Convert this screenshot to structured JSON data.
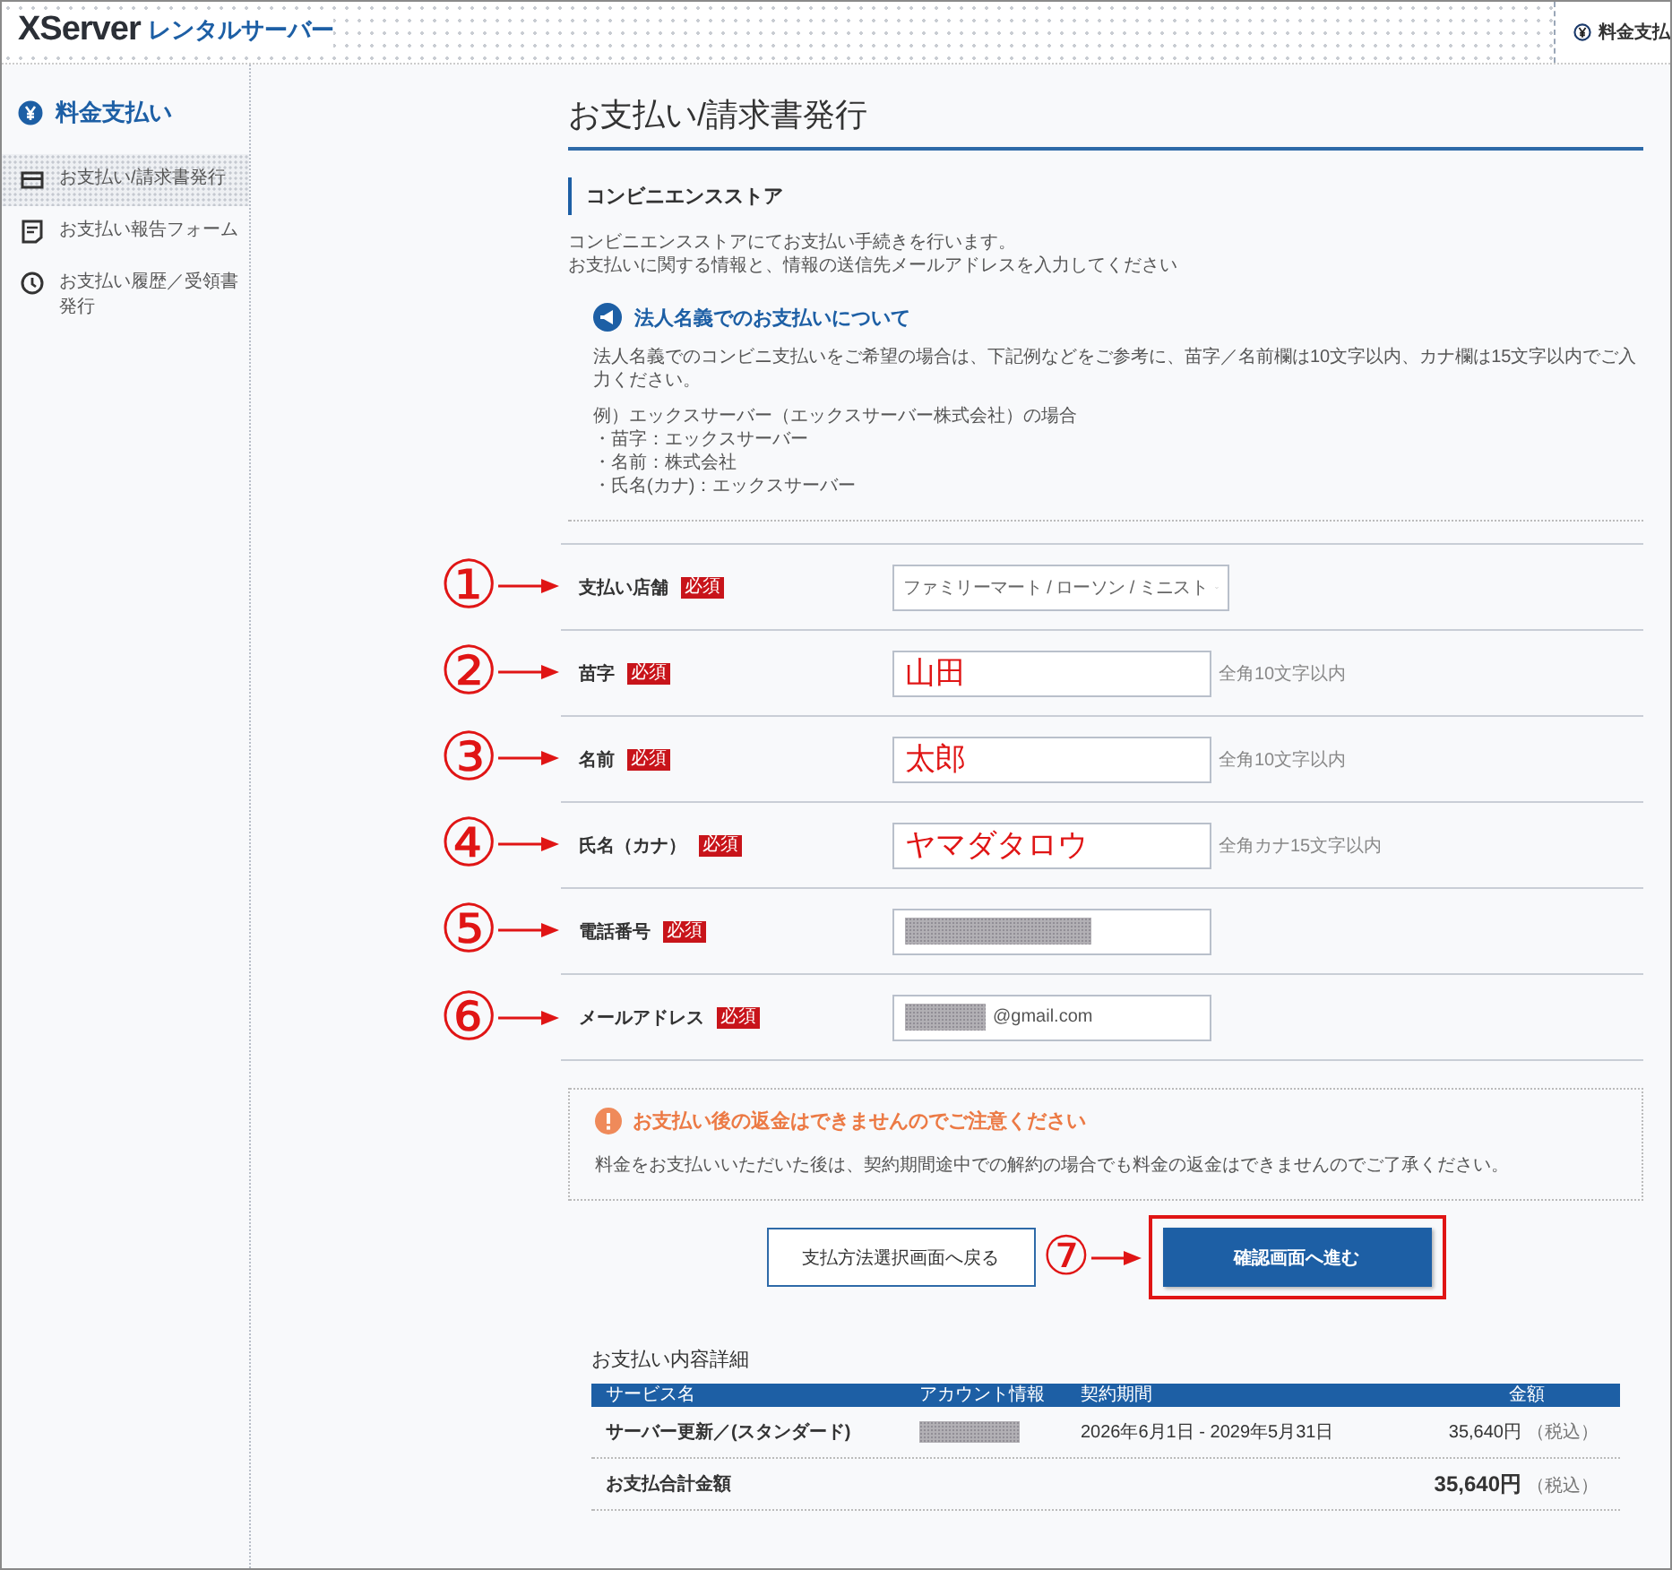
{
  "header": {
    "logo_main": "XServer",
    "logo_sub": "レンタルサーバー",
    "menu_label": "料金支払"
  },
  "sidebar": {
    "title": "料金支払い",
    "items": [
      {
        "label": "お支払い/請求書発行",
        "selected": true
      },
      {
        "label": "お支払い報告フォーム",
        "selected": false
      },
      {
        "label": "お支払い履歴／受領書発行",
        "selected": false
      }
    ]
  },
  "page_title": "お支払い/請求書発行",
  "section_title": "コンビニエンスストア",
  "intro": [
    "コンビニエンスストアにてお支払い手続きを行います。",
    "お支払いに関する情報と、情報の送信先メールアドレスを入力してください"
  ],
  "notice": {
    "title": "法人名義でのお支払いについて",
    "body": "法人名義でのコンビニ支払いをご希望の場合は、下記例などをご参考に、苗字／名前欄は10文字以内、カナ欄は15文字以内でご入力ください。",
    "example": [
      "例）エックスサーバー（エックスサーバー株式会社）の場合",
      "・苗字：エックスサーバー",
      "・名前：株式会社",
      "・氏名(カナ)：エックスサーバー"
    ]
  },
  "form": {
    "rows": [
      {
        "annotation": "①",
        "label": "支払い店舗",
        "badge": "必須",
        "kind": "select",
        "value": "ファミリーマート / ローソン / ミニスト"
      },
      {
        "annotation": "②",
        "label": "苗字",
        "badge": "必須",
        "kind": "text",
        "value": "山田",
        "hint": "全角10文字以内",
        "highlighted": true
      },
      {
        "annotation": "③",
        "label": "名前",
        "badge": "必須",
        "kind": "text",
        "value": "太郎",
        "hint": "全角10文字以内",
        "highlighted": true
      },
      {
        "annotation": "④",
        "label": "氏名（カナ）",
        "badge": "必須",
        "kind": "text",
        "value": "ヤマダタロウ",
        "hint": "全角カナ15文字以内",
        "highlighted": true
      },
      {
        "annotation": "⑤",
        "label": "電話番号",
        "badge": "必須",
        "kind": "text",
        "redacted": true
      },
      {
        "annotation": "⑥",
        "label": "メールアドレス",
        "badge": "必須",
        "kind": "text",
        "value": "@gmail.com",
        "highlighted": false,
        "redacted": true
      }
    ]
  },
  "warning": {
    "title": "お支払い後の返金はできませんのでご注意ください",
    "body": "料金をお支払いいただいた後は、契約期間途中での解約の場合でも料金の返金はできませんのでご了承ください。"
  },
  "buttons": [
    {
      "kind": "secondary",
      "label": "支払方法選択画面へ戻る",
      "highlighted": false
    },
    {
      "kind": "primary",
      "label": "確認画面へ進む",
      "highlighted": true,
      "annotation": "⑦"
    }
  ],
  "details": {
    "title": "お支払い内容詳細",
    "columns": [
      "サービス名",
      "アカウント情報",
      "契約期間",
      "金額"
    ],
    "rows": [
      {
        "service": "サーバー更新／(スタンダード)",
        "account_redacted": true,
        "period": "2026年6月1日 - 2029年5月31日",
        "amount": "35,640円",
        "tax": "（税込）"
      }
    ],
    "total": {
      "label": "お支払合計金額",
      "amount": "35,640円",
      "tax": "（税込）"
    }
  }
}
